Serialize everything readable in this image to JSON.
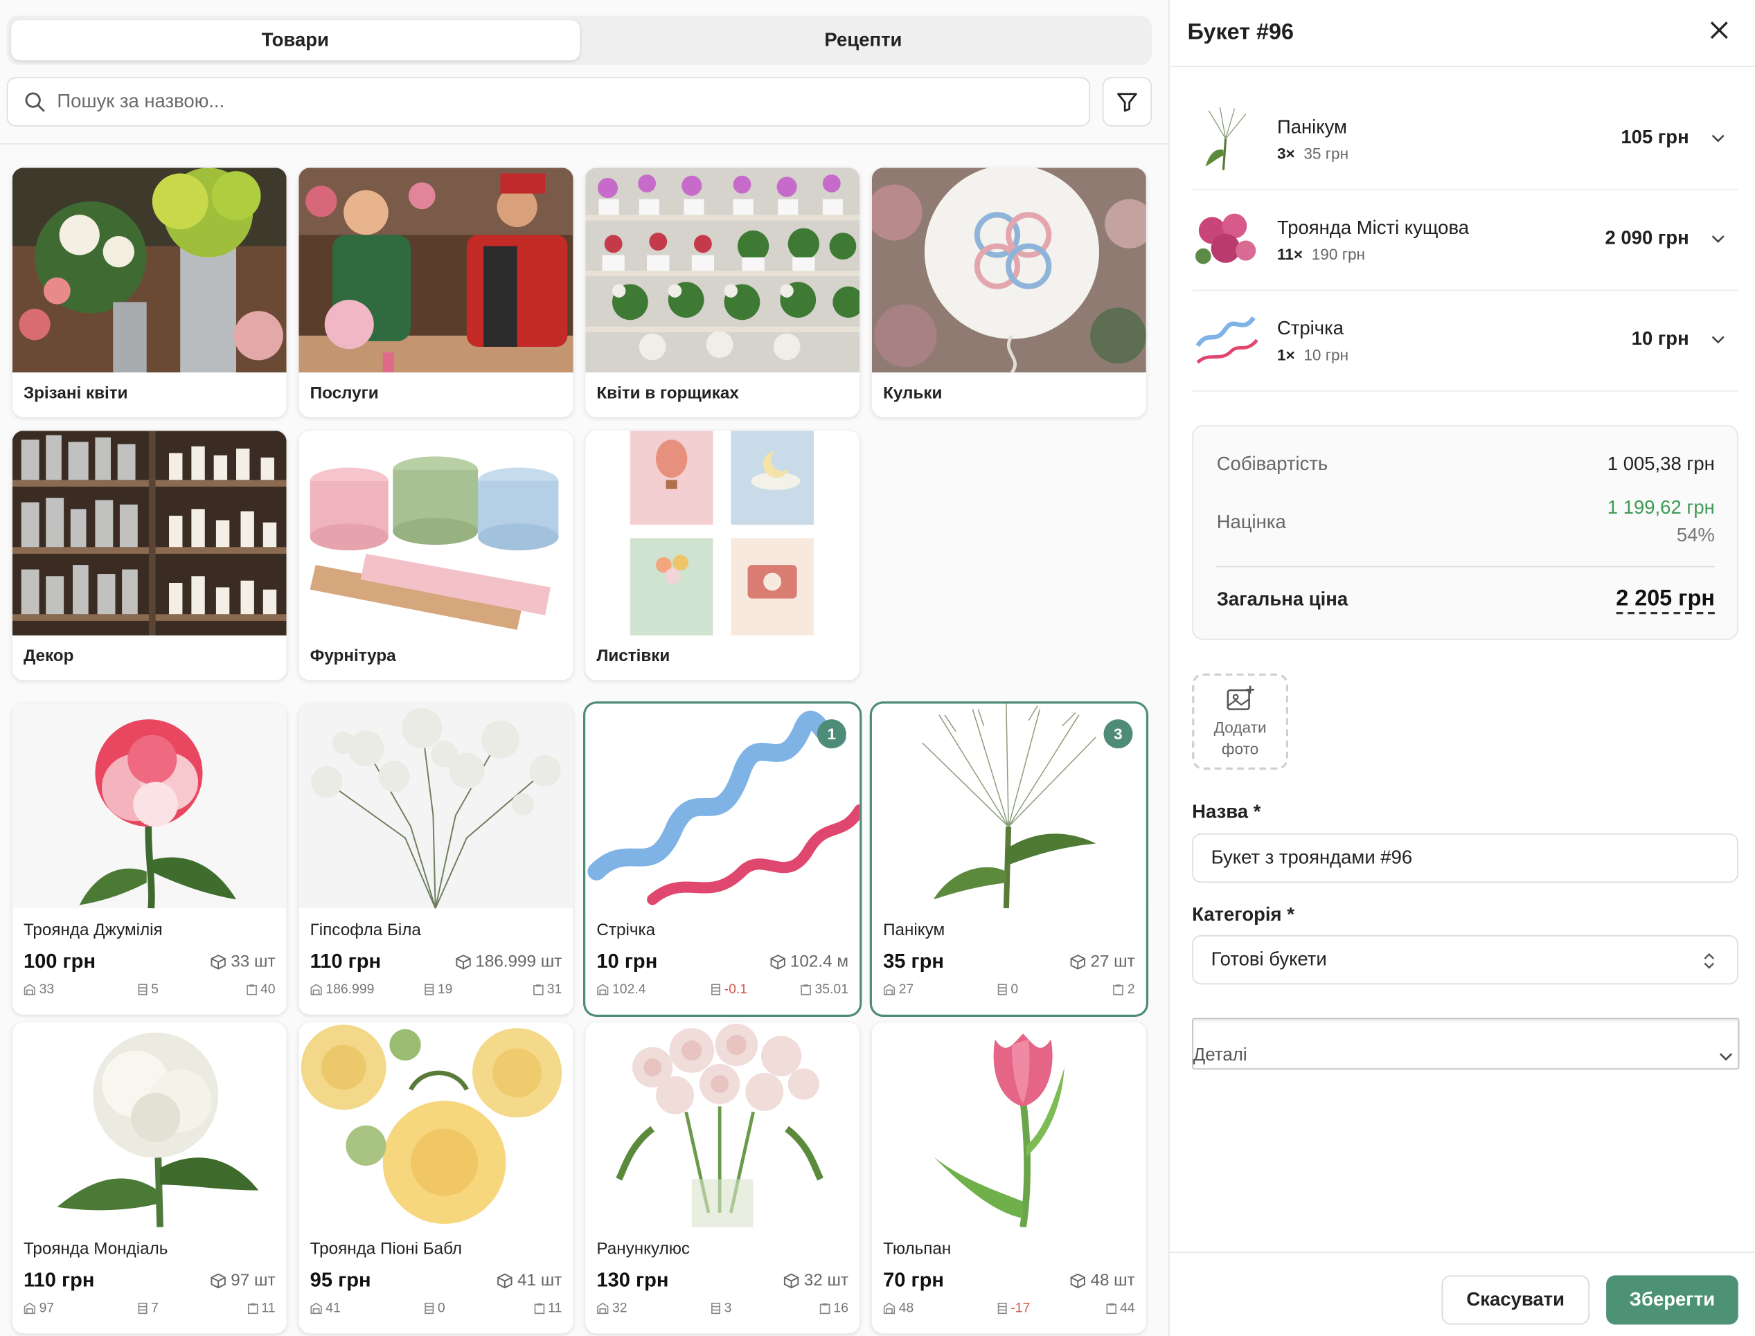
{
  "tabs": [
    {
      "label": "Товари",
      "active": true
    },
    {
      "label": "Рецепти",
      "active": false
    }
  ],
  "search": {
    "placeholder": "Пошук за назвою..."
  },
  "categories": [
    {
      "label": "Зрізані квіти",
      "icon": "cut-flowers-photo"
    },
    {
      "label": "Послуги",
      "icon": "services-photo"
    },
    {
      "label": "Квіти в горщиках",
      "icon": "potted-flowers-photo"
    },
    {
      "label": "Кульки",
      "icon": "balloon-photo"
    },
    {
      "label": "Декор",
      "icon": "decor-photo"
    },
    {
      "label": "Фурнітура",
      "icon": "supplies-photo"
    },
    {
      "label": "Листівки",
      "icon": "postcards-photo"
    }
  ],
  "products": [
    {
      "name": "Троянда Джумілія",
      "price": "100 грн",
      "stock": "33 шт",
      "m1": "33",
      "m2": "5",
      "m3": "40",
      "m2_negative": false,
      "selected": false,
      "badge": ""
    },
    {
      "name": "Гіпсофла Біла",
      "price": "110 грн",
      "stock": "186.999 шт",
      "m1": "186.999",
      "m2": "19",
      "m3": "31",
      "m2_negative": false,
      "selected": false,
      "badge": ""
    },
    {
      "name": "Стрічка",
      "price": "10 грн",
      "stock": "102.4 м",
      "m1": "102.4",
      "m2": "-0.1",
      "m3": "35.01",
      "m2_negative": true,
      "selected": true,
      "badge": "1"
    },
    {
      "name": "Панікум",
      "price": "35 грн",
      "stock": "27 шт",
      "m1": "27",
      "m2": "0",
      "m3": "2",
      "m2_negative": false,
      "selected": true,
      "badge": "3"
    },
    {
      "name": "Троянда Мондіаль",
      "price": "110 грн",
      "stock": "97 шт",
      "m1": "97",
      "m2": "7",
      "m3": "11",
      "m2_negative": false,
      "selected": false,
      "badge": ""
    },
    {
      "name": "Троянда Піоні Бабл",
      "price": "95 грн",
      "stock": "41 шт",
      "m1": "41",
      "m2": "0",
      "m3": "11",
      "m2_negative": false,
      "selected": false,
      "badge": ""
    },
    {
      "name": "Ранункулюс",
      "price": "130 грн",
      "stock": "32 шт",
      "m1": "32",
      "m2": "3",
      "m3": "16",
      "m2_negative": false,
      "selected": false,
      "badge": ""
    },
    {
      "name": "Тюльпан",
      "price": "70 грн",
      "stock": "48 шт",
      "m1": "48",
      "m2": "-17",
      "m3": "44",
      "m2_negative": true,
      "selected": false,
      "badge": ""
    }
  ],
  "panel": {
    "title": "Букет #96",
    "lines": [
      {
        "name": "Панікум",
        "qty": "3×",
        "unit_price": "35 грн",
        "total": "105 грн"
      },
      {
        "name": "Троянда Місті кущова",
        "qty": "11×",
        "unit_price": "190 грн",
        "total": "2 090 грн"
      },
      {
        "name": "Стрічка",
        "qty": "1×",
        "unit_price": "10 грн",
        "total": "10 грн"
      }
    ],
    "summary": {
      "cost_label": "Собівартість",
      "cost_value": "1 005,38 грн",
      "markup_label": "Націнка",
      "markup_value": "1 199,62 грн",
      "markup_percent": "54%",
      "total_label": "Загальна ціна",
      "total_value": "2 205 грн"
    },
    "add_photo_label_1": "Додати",
    "add_photo_label_2": "фото",
    "name_label": "Назва *",
    "name_value": "Букет з трояндами #96",
    "category_label": "Категорія *",
    "category_value": "Готові букети",
    "details_label": "Деталі",
    "cancel_label": "Скасувати",
    "save_label": "Зберегти"
  },
  "colors": {
    "accent": "#4e9275",
    "selected_border": "#4e8c78",
    "negative": "#d0574e",
    "markup_green": "#3f9a55"
  }
}
